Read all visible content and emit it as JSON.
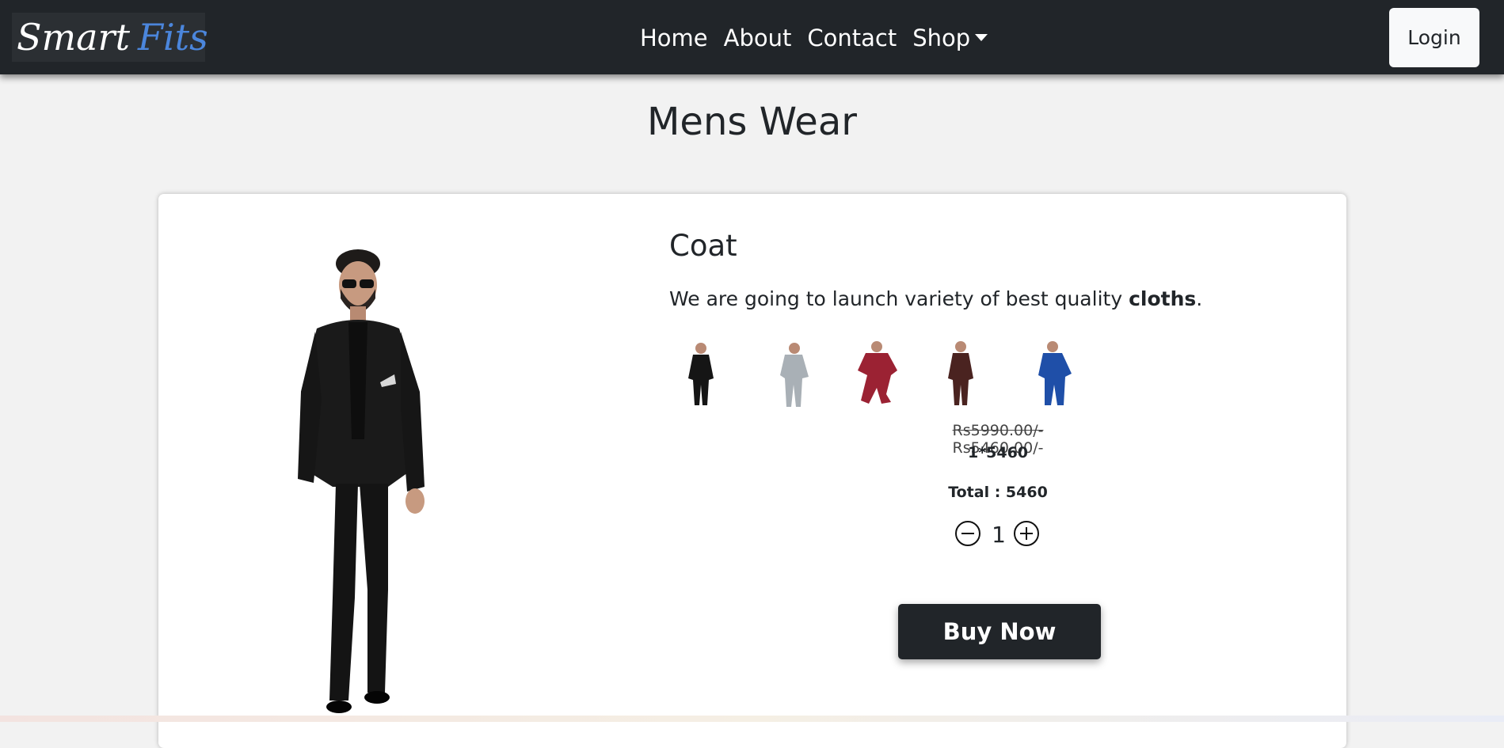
{
  "navbar": {
    "brand_word1": "Smart",
    "brand_word2": "Fits",
    "links": [
      "Home",
      "About",
      "Contact",
      "Shop"
    ],
    "login_label": "Login"
  },
  "page": {
    "title": "Mens Wear"
  },
  "product": {
    "title": "Coat",
    "description_prefix": "We are going to launch variety of best quality ",
    "description_bold": "cloths",
    "description_suffix": ".",
    "thumbnails": [
      {
        "color": "#151515",
        "name": "black-suit"
      },
      {
        "color": "#a9b0b6",
        "name": "grey-suit"
      },
      {
        "color": "#9b2233",
        "name": "maroon-suit"
      },
      {
        "color": "#4a2320",
        "name": "brown-suit"
      },
      {
        "color": "#1f4fa8",
        "name": "blue-suit"
      }
    ],
    "old_price": "Rs5990.00/-",
    "new_price": "Rs5460.00/-",
    "calculation": "1*5460",
    "total": "Total : 5460",
    "quantity": "1",
    "buy_label": "Buy Now"
  },
  "colors": {
    "navbar_bg": "#212529",
    "page_bg": "#f2f2f2",
    "brand_accent": "#4b86dc",
    "button_dark": "#212529"
  },
  "icons": {
    "decrement": "minus-circle-icon",
    "increment": "plus-circle-icon",
    "dropdown": "caret-down-icon"
  }
}
